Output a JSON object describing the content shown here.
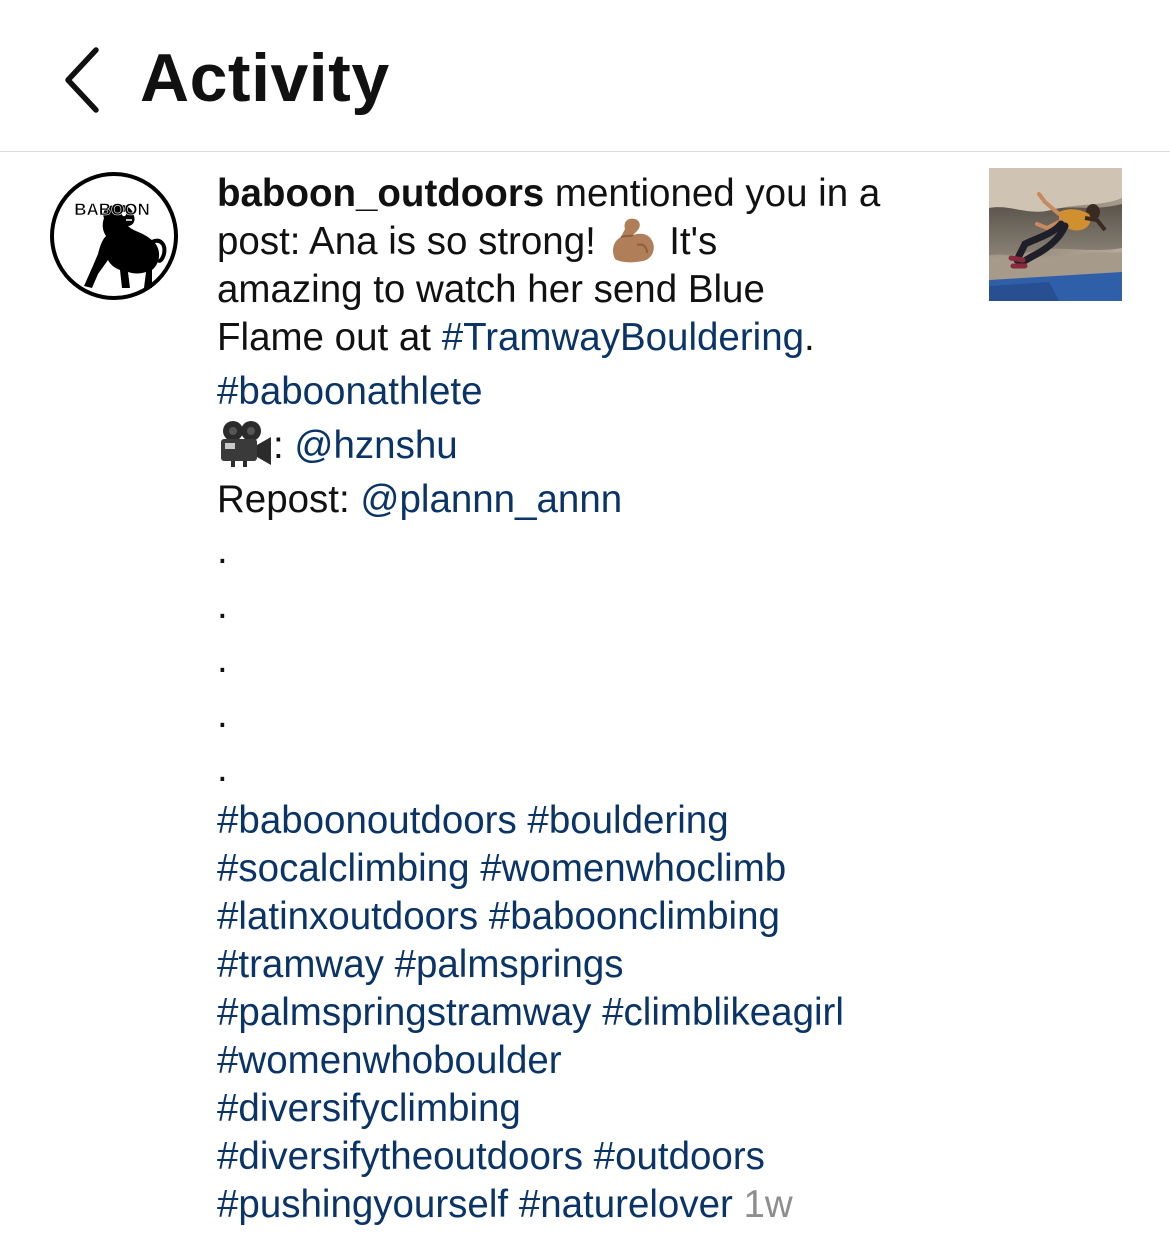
{
  "header": {
    "title": "Activity",
    "back_icon": "chevron-left-icon"
  },
  "notification": {
    "avatar": {
      "brand_text": "BABOON",
      "icon": "baboon-logo"
    },
    "username": "baboon_outdoors",
    "lines": {
      "l1_rest": " mentioned you in a",
      "l2_a": "post: Ana is so strong! ",
      "l2_b": " It's",
      "l3": "amazing to watch her send Blue",
      "l4_a": "Flame out at ",
      "l4_tag": "#TramwayBouldering",
      "l4_b": ".",
      "l5_tag": "#baboonathlete",
      "l6_a": ": ",
      "l6_mention": "@hznshu",
      "l7_a": "Repost: ",
      "l7_mention": "@plannn_annn",
      "dot": "."
    },
    "hashtag_lines": [
      "#baboonoutdoors #bouldering",
      "#socalclimbing #womenwhoclimb",
      "#latinxoutdoors #baboonclimbing",
      "#tramway #palmsprings",
      "#palmspringstramway #climblikeagirl",
      "#womenwhoboulder",
      "#diversifyclimbing",
      "#diversifytheoutdoors #outdoors"
    ],
    "last_line_tags": "#pushingyourself #naturelover",
    "timestamp": "1w",
    "emoji": {
      "muscle": "flexed-biceps-medium-skin-emoji",
      "camera": "movie-camera-emoji"
    },
    "post_thumbnail": "climber-bouldering-photo"
  },
  "colors": {
    "hashtag": "#0a3468",
    "timestamp": "#8e8e8e",
    "divider": "#dbdbdb",
    "text": "#111111"
  }
}
